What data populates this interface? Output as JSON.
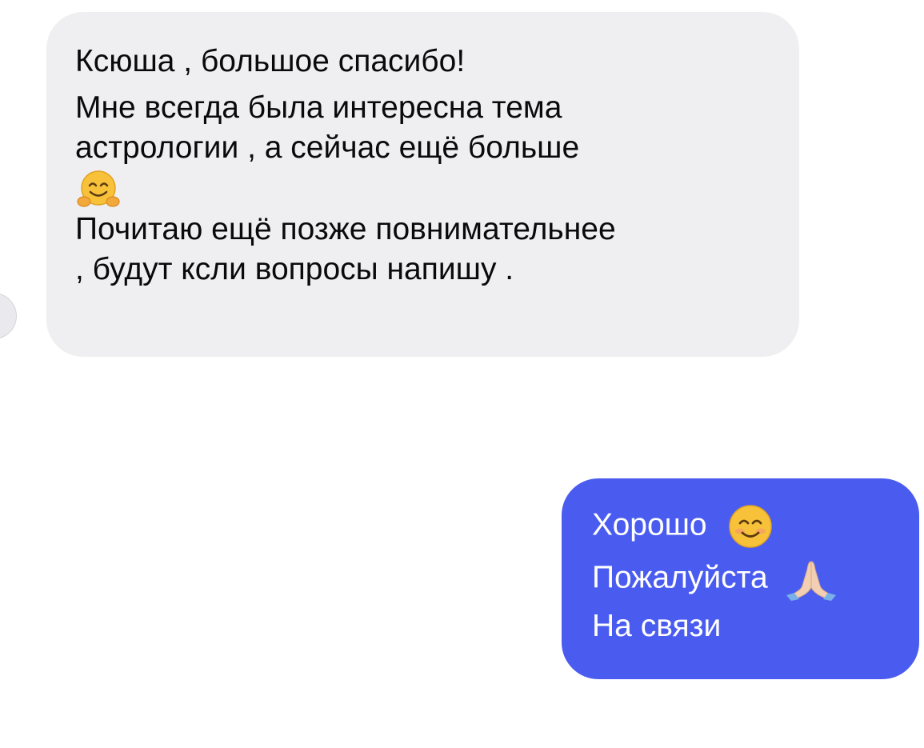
{
  "conversation": {
    "incoming": {
      "line1": "Ксюша , большое спасибо!",
      "line2": "Мне всегда была интересна тема",
      "line3": "астрологии , а сейчас ещё больше",
      "line4_emoji": "hugging-face-emoji",
      "line5": "Почитаю ещё позже повнимательнее",
      "line6": ", будут ксли вопросы напишу ."
    },
    "outgoing": {
      "line1": "Хорошо",
      "line1_emoji": "smiling-face-emoji",
      "line2": "Пожалуйста",
      "line2_emoji": "folded-hands-emoji",
      "line3": "На связи"
    }
  },
  "colors": {
    "incoming_bubble": "#efeff1",
    "outgoing_bubble": "#4a5cf0",
    "incoming_text": "#0a0a0a",
    "outgoing_text": "#ffffff"
  }
}
